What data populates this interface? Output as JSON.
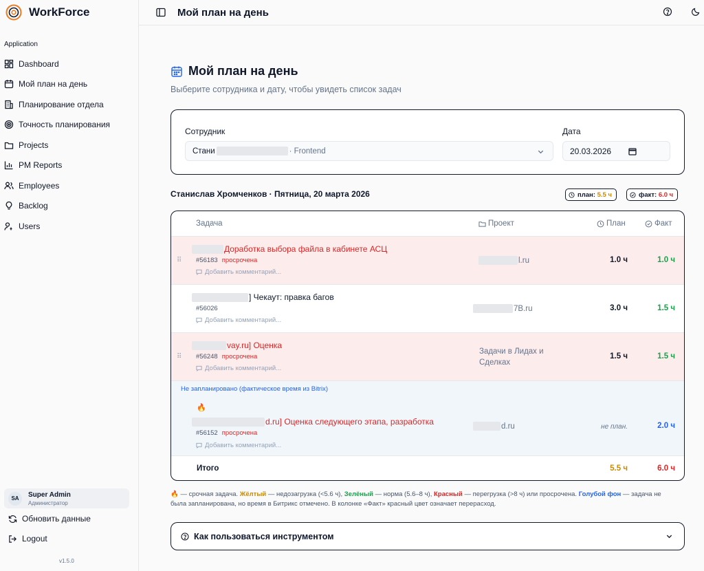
{
  "app": {
    "name": "WorkForce",
    "version": "v1.5.0"
  },
  "sidebar": {
    "group_label": "Application",
    "items": [
      {
        "label": "Dashboard",
        "icon": "dashboard-icon"
      },
      {
        "label": "Мой план на день",
        "icon": "calendar-icon"
      },
      {
        "label": "Планирование отдела",
        "icon": "building-icon"
      },
      {
        "label": "Точность планирования",
        "icon": "target-icon"
      },
      {
        "label": "Projects",
        "icon": "folder-icon"
      },
      {
        "label": "PM Reports",
        "icon": "chart-icon"
      },
      {
        "label": "Employees",
        "icon": "users-icon"
      },
      {
        "label": "Backlog",
        "icon": "lightbulb-icon"
      },
      {
        "label": "Users",
        "icon": "user-key-icon"
      }
    ],
    "user": {
      "initials": "SA",
      "name": "Super Admin",
      "role": "Администратор"
    },
    "refresh_label": "Обновить данные",
    "logout_label": "Logout"
  },
  "topbar": {
    "title": "Мой план на день"
  },
  "page": {
    "title": "Мой план на день",
    "subtitle": "Выберите сотрудника и дату, чтобы увидеть список задач"
  },
  "filters": {
    "employee_label": "Сотрудник",
    "employee_value_prefix": "Стани",
    "employee_value_suffix": "· Frontend",
    "date_label": "Дата",
    "date_value": "20.03.2026"
  },
  "summary": {
    "employee_line": "Станислав Хромченков · Пятница, 20 марта 2026",
    "plan_label": "план:",
    "plan_value": "5.5 ч",
    "fact_label": "факт:",
    "fact_value": "6.0 ч"
  },
  "table": {
    "headers": {
      "task": "Задача",
      "project": "Проект",
      "plan": "План",
      "fact": "Факт"
    },
    "rows": [
      {
        "title": "Доработка выбора файла в кабинете АСЦ",
        "id": "#56183",
        "status": "просрочена",
        "project": "l.ru",
        "plan": "1.0 ч",
        "fact": "1.0 ч"
      },
      {
        "title": "] Чекаут: правка багов",
        "id": "#56026",
        "status": "",
        "project": "7B.ru",
        "plan": "3.0 ч",
        "fact": "1.5 ч"
      },
      {
        "title": "vay.ru] Оценка",
        "id": "#56248",
        "status": "просрочена",
        "project": "Задачи в Лидах и Сделках",
        "plan": "1.5 ч",
        "fact": "1.5 ч"
      }
    ],
    "unplanned_label": "Не запланировано (фактическое время из Bitrix)",
    "unplanned_row": {
      "title": "d.ru] Оценка следующего этапа, разработка",
      "id": "#56152",
      "status": "просрочена",
      "project": "d.ru",
      "plan": "не план.",
      "fact": "2.0 ч"
    },
    "comment_placeholder": "Добавить комментарий...",
    "total": {
      "label": "Итого",
      "plan": "5.5 ч",
      "fact": "6.0 ч"
    }
  },
  "legend": {
    "p1": " — срочная задача. ",
    "yellow": "Жёлтый",
    "p2": " — недозагрузка (<5.6 ч), ",
    "green": "Зелёный",
    "p3": " — норма (5.6–8 ч), ",
    "red": "Красный",
    "p4": " — перегрузка (>8 ч) или просрочена. ",
    "blue": "Голубой фон",
    "p5": " — задача не была запланирована, но время в Битрикс отмечено. В колонке «Факт» красный цвет означает перерасход."
  },
  "faq": {
    "title": "Как пользоваться инструментом"
  },
  "colors": {
    "red_bg": "#fdecec",
    "blue_bg": "#f1f6fb",
    "green": "#16a34a",
    "red": "#dc2626",
    "yellow": "#ca8a04",
    "blue": "#2563eb"
  }
}
